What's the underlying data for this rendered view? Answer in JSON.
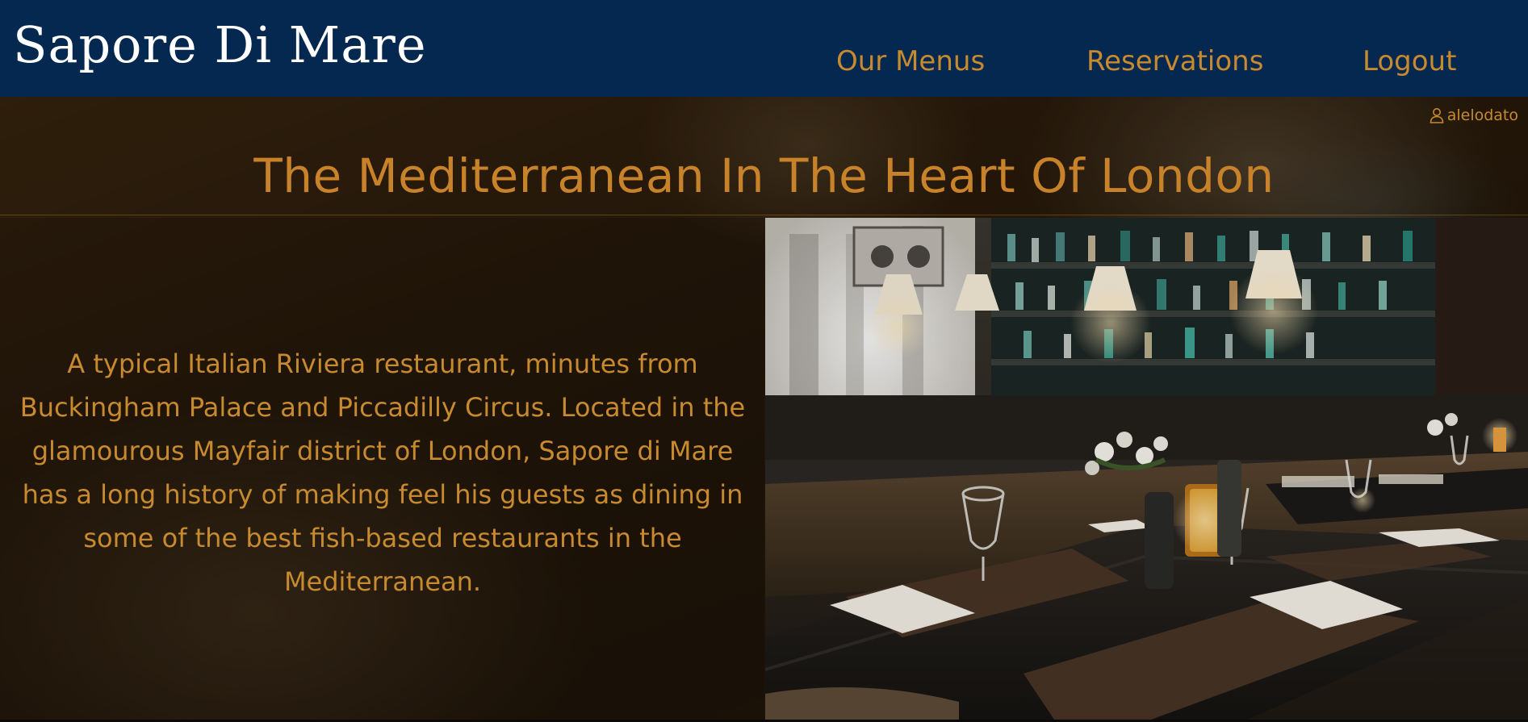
{
  "brand": {
    "name": "Sapore Di Mare"
  },
  "nav": {
    "menus": "Our Menus",
    "reservations": "Reservations",
    "logout": "Logout"
  },
  "user": {
    "username": "alelodato",
    "icon": "user-icon"
  },
  "hero": {
    "title": "The Mediterranean In The Heart Of London",
    "description": "A typical Italian Riviera restaurant, minutes from Buckingham Palace and Piccadilly Circus. Located in the glamourous Mayfair district of London, Sapore di Mare has a long history of making feel his guests as dining in some of the best fish-based restaurants in the Mediterranean."
  },
  "colors": {
    "navbar": "#04284f",
    "accent": "#c88a2e",
    "brand_text": "#ffffff"
  }
}
